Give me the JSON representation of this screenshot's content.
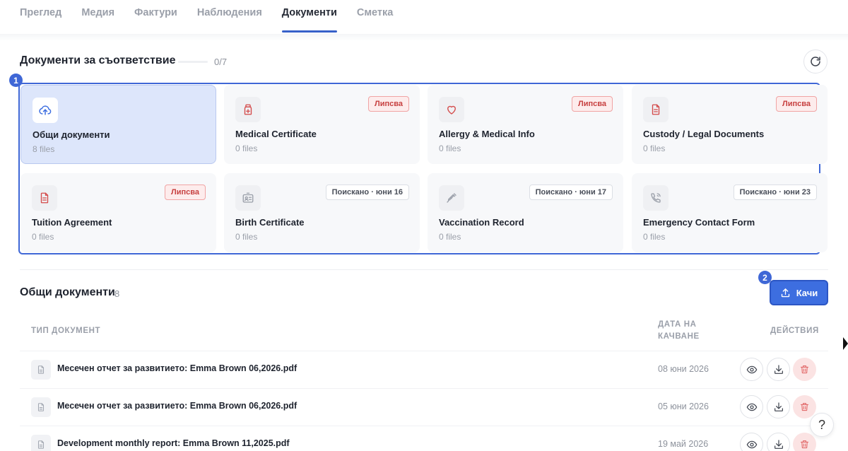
{
  "tabs": [
    "Преглед",
    "Медия",
    "Фактури",
    "Наблюдения",
    "Документи",
    "Сметка"
  ],
  "compliance": {
    "title": "Документи за съответствие",
    "progress_text": "0/7",
    "progress_value": 0
  },
  "markers": {
    "first": "1",
    "second": "2"
  },
  "cards": [
    {
      "title": "Общи документи",
      "count": "8 files",
      "badge": "",
      "icon": "cloud-upload-icon"
    },
    {
      "title": "Medical Certificate",
      "count": "0 files",
      "badge": "Липсва",
      "icon": "medical-bottle-icon"
    },
    {
      "title": "Allergy & Medical Info",
      "count": "0 files",
      "badge": "Липсва",
      "icon": "heart-icon"
    },
    {
      "title": "Custody / Legal Documents",
      "count": "0 files",
      "badge": "Липсва",
      "icon": "document-icon"
    },
    {
      "title": "Tuition Agreement",
      "count": "0 files",
      "badge": "Липсва",
      "icon": "document-icon"
    },
    {
      "title": "Birth Certificate",
      "count": "0 files",
      "badge": "Поискано · юни 16",
      "icon": "id-card-icon"
    },
    {
      "title": "Vaccination Record",
      "count": "0 files",
      "badge": "Поискано · юни 17",
      "icon": "syringe-icon"
    },
    {
      "title": "Emergency Contact Form",
      "count": "0 files",
      "badge": "Поискано · юни 23",
      "icon": "phone-icon"
    }
  ],
  "documents": {
    "title": "Общи документи",
    "count": "8",
    "upload_label": "Качи",
    "headers": {
      "type": "ТИП ДОКУМЕНТ",
      "date": "ДАТА НА КАЧВАНЕ",
      "actions": "ДЕЙСТВИЯ"
    },
    "rows": [
      {
        "name": "Месечен отчет за развитието: Emma Brown 06,2026.pdf",
        "date": "08 юни 2026"
      },
      {
        "name": "Месечен отчет за развитието: Emma Brown 06,2026.pdf",
        "date": "05 юни 2026"
      },
      {
        "name": "Development monthly report: Emma Brown 11,2025.pdf",
        "date": "19 май 2026"
      }
    ]
  },
  "help_label": "?",
  "colors": {
    "accent": "#3f67d6",
    "missing": "#c74040",
    "selected_card": "#dde6fb"
  }
}
